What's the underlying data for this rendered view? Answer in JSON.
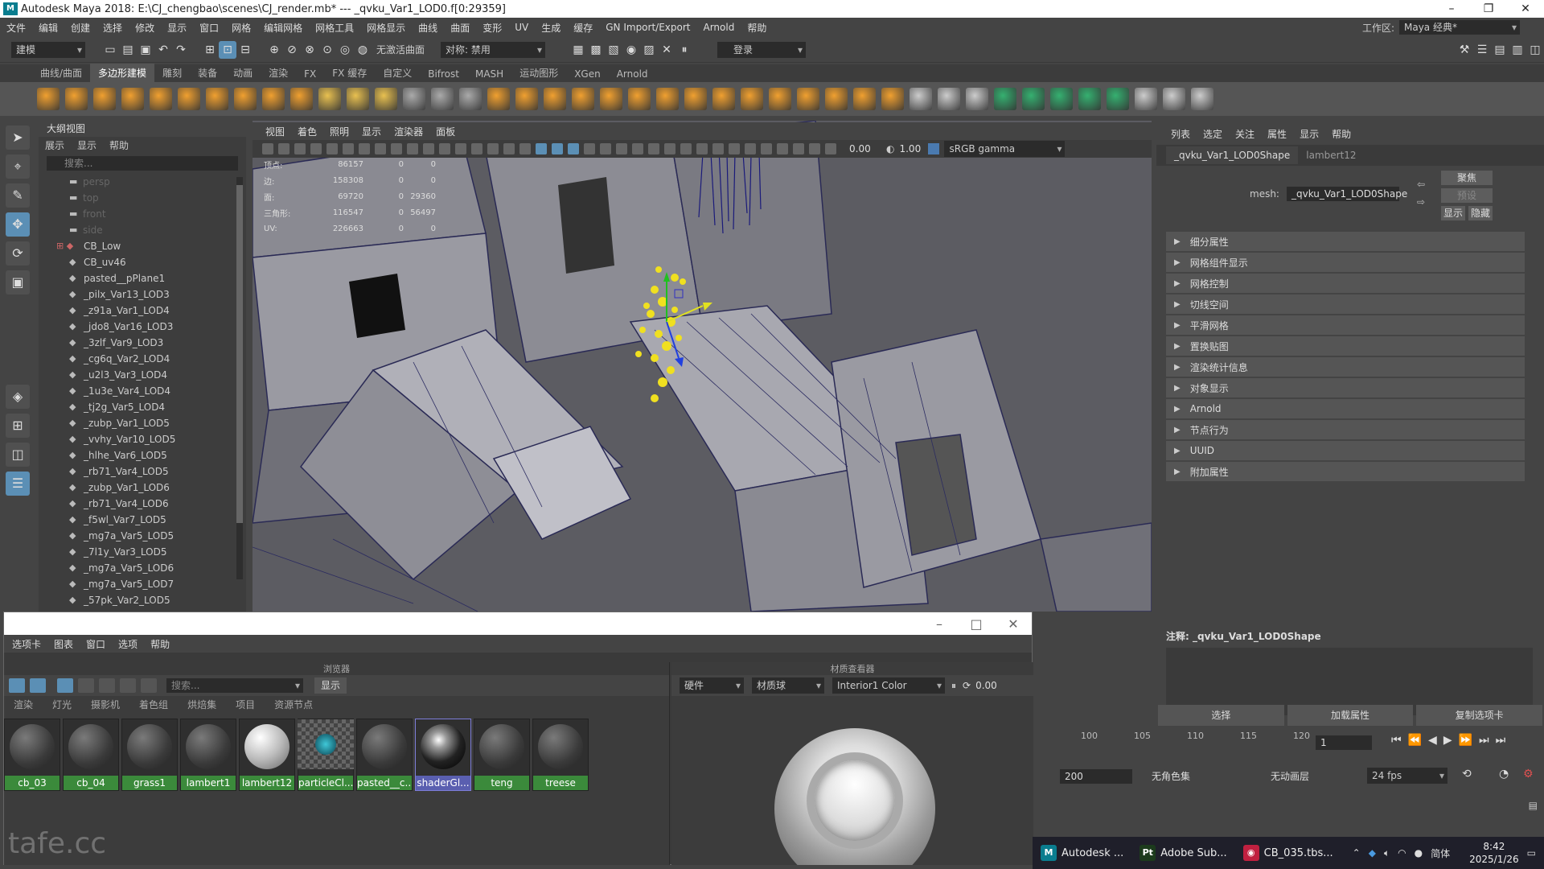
{
  "title": {
    "text": "Autodesk Maya 2018: E:\\CJ_chengbao\\scenes\\CJ_render.mb*   ---   _qvku_Var1_LOD0.f[0:29359]",
    "logo": "M"
  },
  "menubar": {
    "items": [
      "文件",
      "编辑",
      "创建",
      "选择",
      "修改",
      "显示",
      "窗口",
      "网格",
      "编辑网格",
      "网格工具",
      "网格显示",
      "曲线",
      "曲面",
      "变形",
      "UV",
      "生成",
      "缓存",
      "GN Import/Export",
      "Arnold",
      "帮助"
    ],
    "workspace_label": "工作区:",
    "workspace_value": "Maya 经典*"
  },
  "statusline": {
    "mode": "建模",
    "surface": "无激活曲面",
    "symmetry": "对称: 禁用",
    "login": "登录"
  },
  "shelf": {
    "tabs": [
      "曲线/曲面",
      "多边形建模",
      "雕刻",
      "装备",
      "动画",
      "渲染",
      "FX",
      "FX 缓存",
      "自定义",
      "Bifrost",
      "MASH",
      "运动图形",
      "XGen",
      "Arnold"
    ],
    "active_tab": 1,
    "icon_colors": [
      "#f0a030",
      "#f0a030",
      "#f0a030",
      "#f0a030",
      "#f0a030",
      "#f0a030",
      "#f0a030",
      "#f0a030",
      "#f0a030",
      "#f0a030",
      "#e8c050",
      "#e8c050",
      "#e8c050",
      "#aaa",
      "#aaa",
      "#aaa",
      "#f0a030",
      "#f0a030",
      "#f0a030",
      "#f0a030",
      "#f0a030",
      "#f0a030",
      "#f0a030",
      "#f0a030",
      "#f0a030",
      "#f0a030",
      "#f0a030",
      "#f0a030",
      "#f0a030",
      "#f0a030",
      "#f0a030",
      "#ccc",
      "#ccc",
      "#ccc",
      "#35b070",
      "#35b070",
      "#35b070",
      "#35b070",
      "#35b070",
      "#ccc",
      "#ccc",
      "#ccc"
    ]
  },
  "outliner": {
    "title": "大纲视图",
    "menu": [
      "展示",
      "显示",
      "帮助"
    ],
    "search_placeholder": "搜索...",
    "cameras": [
      "persp",
      "top",
      "front",
      "side"
    ],
    "items": [
      "CB_Low",
      "CB_uv46",
      "pasted__pPlane1",
      "_pilx_Var13_LOD3",
      "_z91a_Var1_LOD4",
      "_jdo8_Var16_LOD3",
      "_3zlf_Var9_LOD3",
      "_cg6q_Var2_LOD4",
      "_u2l3_Var3_LOD4",
      "_1u3e_Var4_LOD4",
      "_tj2g_Var5_LOD4",
      "_zubp_Var1_LOD5",
      "_vvhy_Var10_LOD5",
      "_hlhe_Var6_LOD5",
      "_rb71_Var4_LOD5",
      "_zubp_Var1_LOD6",
      "_rb71_Var4_LOD6",
      "_f5wl_Var7_LOD5",
      "_mg7a_Var5_LOD5",
      "_7l1y_Var3_LOD5",
      "_mg7a_Var5_LOD6",
      "_mg7a_Var5_LOD7",
      "_57pk_Var2_LOD5"
    ]
  },
  "viewport": {
    "menu": [
      "视图",
      "着色",
      "照明",
      "显示",
      "渲染器",
      "面板"
    ],
    "exposure": "0.00",
    "gamma": "1.00",
    "colorspace": "sRGB gamma",
    "hud": [
      {
        "label": "顶点:",
        "a": "86157",
        "b": "0",
        "c": "0"
      },
      {
        "label": "边:",
        "a": "158308",
        "b": "0",
        "c": "0"
      },
      {
        "label": "面:",
        "a": "69720",
        "b": "0",
        "c": "29360"
      },
      {
        "label": "三角形:",
        "a": "116547",
        "b": "0",
        "c": "56497"
      },
      {
        "label": "UV:",
        "a": "226663",
        "b": "0",
        "c": "0"
      }
    ]
  },
  "attribute_editor": {
    "menu": [
      "列表",
      "选定",
      "关注",
      "属性",
      "显示",
      "帮助"
    ],
    "tab_active": "_qvku_Var1_LOD0Shape",
    "tab_other": "lambert12",
    "mesh_label": "mesh:",
    "mesh_value": "_qvku_Var1_LOD0Shape",
    "focus_btn": "聚焦",
    "preset_btn": "预设",
    "show_btn": "显示",
    "hide_btn": "隐藏",
    "sections": [
      "细分属性",
      "网格组件显示",
      "网格控制",
      "切线空间",
      "平滑网格",
      "置换贴图",
      "渲染统计信息",
      "对象显示",
      "Arnold",
      "节点行为",
      "UUID",
      "附加属性"
    ],
    "notes_label": "注释:  _qvku_Var1_LOD0Shape",
    "bottom_buttons": [
      "选择",
      "加载属性",
      "复制选项卡"
    ]
  },
  "timeline": {
    "ticks": [
      "100",
      "105",
      "110",
      "115",
      "120"
    ],
    "current_frame": "1",
    "end_frame": "200",
    "char_set": "无角色集",
    "anim_layer": "无动画层",
    "fps": "24 fps"
  },
  "hypershade": {
    "menu": [
      "选项卡",
      "图表",
      "窗口",
      "选项",
      "帮助"
    ],
    "browser_title": "浏览器",
    "search_placeholder": "搜索...",
    "show_btn": "显示",
    "categories": [
      "渲染",
      "灯光",
      "摄影机",
      "着色组",
      "烘焙集",
      "项目",
      "资源节点"
    ],
    "materials": [
      {
        "name": "cb_03",
        "style": "dark"
      },
      {
        "name": "cb_04",
        "style": "dark"
      },
      {
        "name": "grass1",
        "style": "dark"
      },
      {
        "name": "lambert1",
        "style": "dark"
      },
      {
        "name": "lambert12",
        "style": "light"
      },
      {
        "name": "particleCl...",
        "style": "particle"
      },
      {
        "name": "pasted__c...",
        "style": "dark"
      },
      {
        "name": "shaderGl...",
        "style": "shader",
        "selected": true
      },
      {
        "name": "teng",
        "style": "dark"
      },
      {
        "name": "treese",
        "style": "dark"
      }
    ],
    "viewer_title": "材质查看器",
    "viewer_renderer": "硬件",
    "viewer_shape": "材质球",
    "viewer_env": "Interior1 Color",
    "viewer_value": "0.00"
  },
  "taskbar": {
    "apps": [
      {
        "label": "Autodesk ...",
        "icon": "M",
        "color": "#0a7d8f"
      },
      {
        "label": "Adobe Sub...",
        "icon": "Pt",
        "color": "#1c3b1c"
      },
      {
        "label": "CB_035.tbs...",
        "icon": "◉",
        "color": "#c02040"
      }
    ],
    "ime": "简体",
    "time": "8:42",
    "date": "2025/1/26"
  },
  "watermark": "tafe.cc"
}
